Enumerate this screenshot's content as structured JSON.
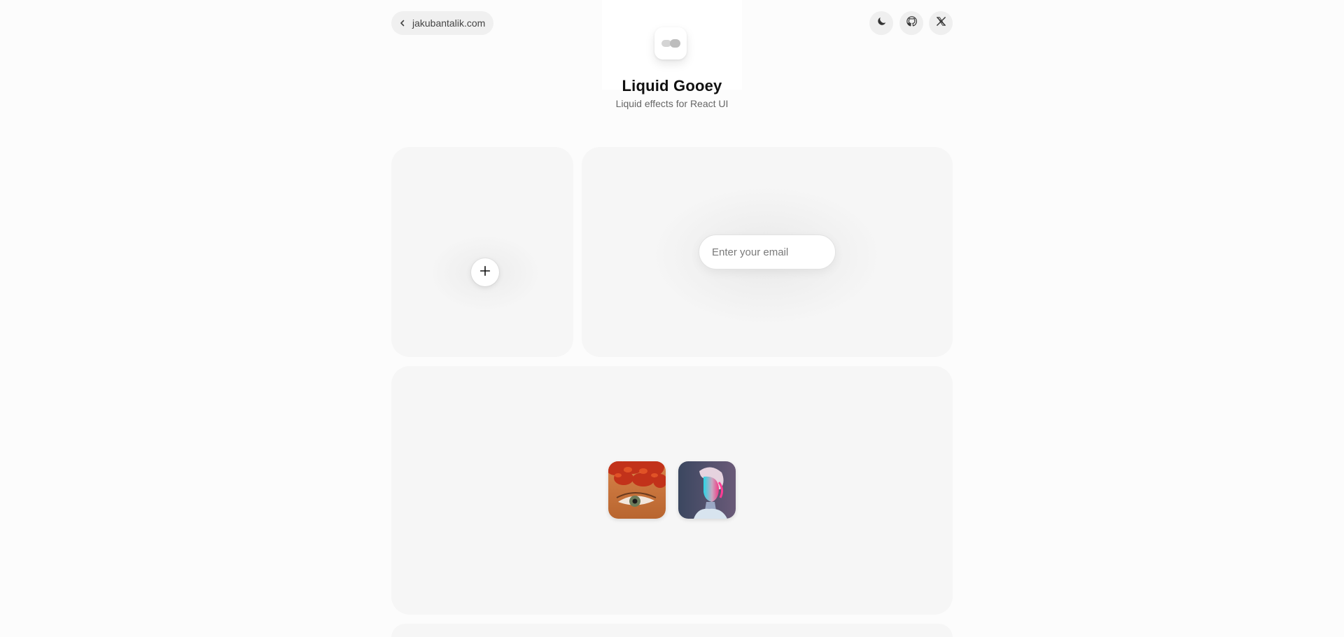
{
  "nav": {
    "back_label": "jakubantalik.com",
    "icons": [
      "chevron-left-icon",
      "moon-icon",
      "github-icon",
      "x-logo-icon"
    ]
  },
  "header": {
    "title": "Liquid Gooey",
    "subtitle": "Liquid effects for React UI"
  },
  "demos": {
    "email_placeholder": "Enter your email",
    "plus_icon": "plus-icon",
    "thumbnails": [
      {
        "name": "eye-with-red-flowers",
        "palette": [
          "#c7401c",
          "#e08a3a",
          "#6a7b5a"
        ]
      },
      {
        "name": "neon-portrait",
        "palette": [
          "#2fd3e0",
          "#e0307a",
          "#4a5060"
        ]
      }
    ]
  },
  "colors": {
    "page_background": "#fcfcfc",
    "card_background": "#f6f6f6",
    "text_primary": "#111111",
    "text_secondary": "#666666"
  }
}
